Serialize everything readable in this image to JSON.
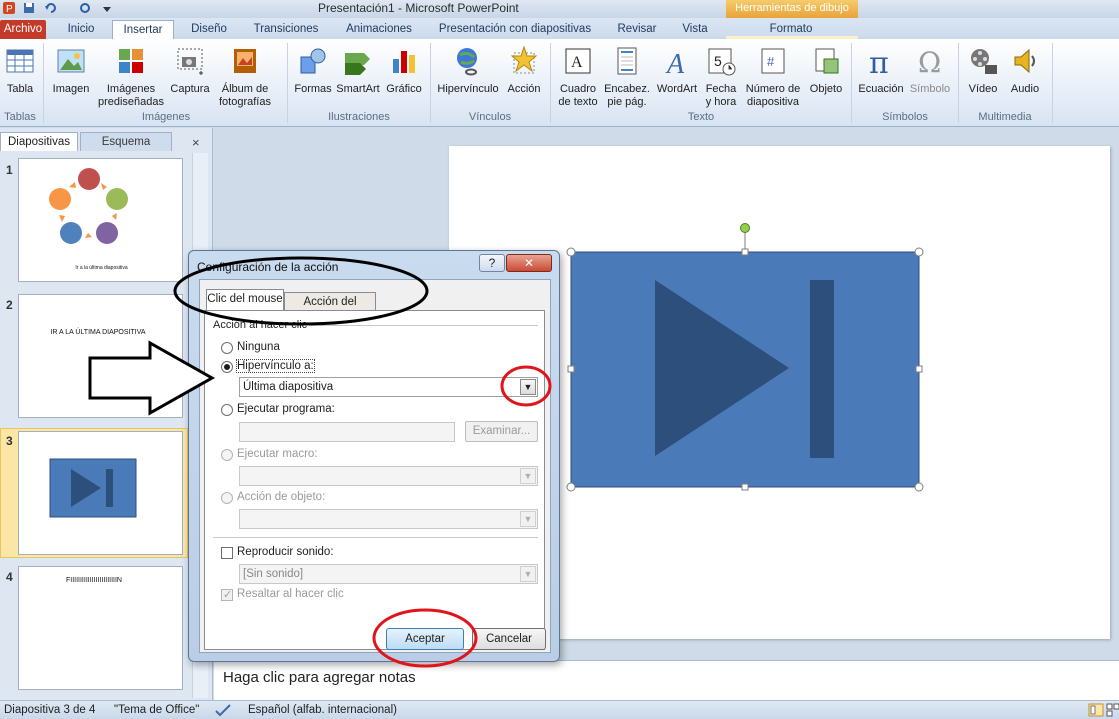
{
  "window": {
    "title": "Presentación1  -  Microsoft PowerPoint",
    "contextual_tab": "Herramientas de dibujo"
  },
  "ribbon_tabs": [
    "Archivo",
    "Inicio",
    "Insertar",
    "Diseño",
    "Transiciones",
    "Animaciones",
    "Presentación con diapositivas",
    "Revisar",
    "Vista",
    "Formato"
  ],
  "ribbon": {
    "tablas": {
      "label": "Tabla",
      "group": "Tablas"
    },
    "imagenes": {
      "imagen": "Imagen",
      "predis_1": "Imágenes",
      "predis_2": "prediseñadas",
      "captura": "Captura",
      "album_1": "Álbum de",
      "album_2": "fotografías",
      "group": "Imágenes"
    },
    "ilustraciones": {
      "formas": "Formas",
      "smartart": "SmartArt",
      "grafico": "Gráfico",
      "group": "Ilustraciones"
    },
    "vinculos": {
      "hipervinculo": "Hipervínculo",
      "accion": "Acción",
      "group": "Vínculos"
    },
    "texto": {
      "cuadro_1": "Cuadro",
      "cuadro_2": "de texto",
      "encab_1": "Encabez.",
      "encab_2": "pie pág.",
      "wordart": "WordArt",
      "fecha_1": "Fecha",
      "fecha_2": "y hora",
      "num_1": "Número de",
      "num_2": "diapositiva",
      "objeto": "Objeto",
      "group": "Texto"
    },
    "simbolos": {
      "ecuacion": "Ecuación",
      "simbolo": "Símbolo",
      "group": "Símbolos"
    },
    "multimedia": {
      "video": "Vídeo",
      "audio": "Audio",
      "group": "Multimedia"
    }
  },
  "left_pane": {
    "tabs": [
      "Diapositivas",
      "Esquema"
    ],
    "close_glyph": "×",
    "slides": [
      {
        "number": "1",
        "caption": "Ir a la última diapositiva"
      },
      {
        "number": "2",
        "text": "IR A LA ÚLTIMA DIAPOSITIVA"
      },
      {
        "number": "3"
      },
      {
        "number": "4",
        "text": "FIIIIIIIIIIIIIIIIIIIIIIIIN"
      }
    ]
  },
  "notes_placeholder": "Haga clic para agregar notas",
  "status": {
    "slide": "Diapositiva 3 de 4",
    "theme": "\"Tema de Office\"",
    "language": "Español (alfab. internacional)"
  },
  "dialog": {
    "title": "Configuración de la acción",
    "help": "?",
    "close": "✕",
    "tabs": [
      "Clic del mouse",
      "Acción del mouse"
    ],
    "group_label": "Acción al hacer clic",
    "options": {
      "ninguna": "Ninguna",
      "hipervinculo": "Hipervínculo a:",
      "hipervinculo_value": "Última diapositiva",
      "ejecutar_programa": "Ejecutar programa:",
      "examinar": "Examinar...",
      "ejecutar_macro": "Ejecutar macro:",
      "accion_objeto": "Acción de objeto:"
    },
    "sound": {
      "label": "Reproducir sonido:",
      "value": "[Sin sonido]",
      "highlight": "Resaltar al hacer clic"
    },
    "buttons": {
      "ok": "Aceptar",
      "cancel": "Cancelar"
    }
  },
  "colors": {
    "annotation_red": "#e0151b",
    "shape_fill": "#4a7ab7",
    "shape_dark": "#2d4f7c",
    "file_tab": "#c33a2b"
  }
}
